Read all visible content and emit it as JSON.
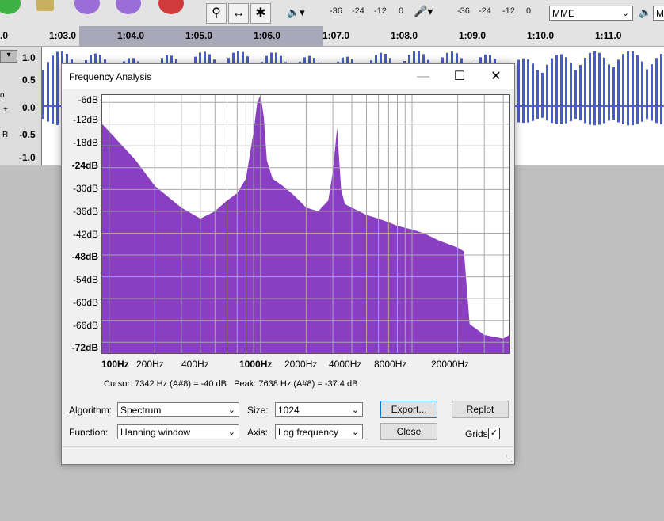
{
  "toolbar": {
    "meter_ticks_play": [
      "-36",
      "-24",
      "-12",
      "0"
    ],
    "meter_ticks_rec": [
      "-36",
      "-24",
      "-12",
      "0"
    ],
    "host": "MME",
    "host_partial": "Mi",
    "tools": [
      "zoom-icon",
      "time-shift-icon",
      "multi-tool-icon"
    ]
  },
  "ruler": {
    "labels": [
      ".0",
      "1:03.0",
      "1:04.0",
      "1:05.0",
      "1:06.0",
      "1:07.0",
      "1:08.0",
      "1:09.0",
      "1:10.0",
      "1:11.0"
    ]
  },
  "track": {
    "scale": [
      "1.0",
      "0.5",
      "0.0",
      "-0.5",
      "-1.0"
    ],
    "side_glyphs": [
      "o",
      "+",
      "R"
    ]
  },
  "dialog": {
    "title": "Frequency Analysis",
    "minimize": "—",
    "maximize": "☐",
    "close": "✕",
    "db_labels": [
      "-6dB",
      "-12dB",
      "-18dB",
      "-24dB",
      "-30dB",
      "-36dB",
      "-42dB",
      "-48dB",
      "-54dB",
      "-60dB",
      "-66dB",
      "-72dB"
    ],
    "hz_labels": [
      "100Hz",
      "200Hz",
      "400Hz",
      "1000Hz",
      "2000Hz",
      "4000Hz",
      "8000Hz",
      "20000Hz"
    ],
    "cursor_text": "Cursor: 7342 Hz (A#8) = -40 dB",
    "peak_text": "Peak: 7638 Hz (A#8) = -37.4 dB",
    "algorithm_label": "Algorithm:",
    "algorithm_value": "Spectrum",
    "function_label": "Function:",
    "function_value": "Hanning window",
    "size_label": "Size:",
    "size_value": "1024",
    "axis_label": "Axis:",
    "axis_value": "Log frequency",
    "export_label": "Export...",
    "close_label": "Close",
    "replot_label": "Replot",
    "grids_label": "Grids",
    "grids_checked": true,
    "spectrum_color": "#8a3ec2"
  },
  "chart_data": {
    "type": "area",
    "xlabel": "",
    "ylabel": "",
    "x_scale": "log",
    "xlim": [
      90,
      44000
    ],
    "ylim": [
      -75,
      -4
    ],
    "x": [
      90,
      100,
      150,
      200,
      300,
      400,
      500,
      600,
      700,
      800,
      900,
      950,
      1000,
      1050,
      1100,
      1200,
      1400,
      1600,
      1800,
      2000,
      2400,
      2800,
      3000,
      3200,
      3400,
      3600,
      4000,
      5000,
      6000,
      7000,
      8000,
      10000,
      12000,
      15000,
      20000,
      22000,
      24000,
      30000,
      40000,
      44000
    ],
    "y": [
      -12,
      -14,
      -22,
      -29,
      -35,
      -38,
      -36,
      -33,
      -31,
      -27,
      -14,
      -6,
      -4,
      -10,
      -22,
      -27,
      -29,
      -31,
      -33,
      -35,
      -36,
      -33,
      -25,
      -13,
      -30,
      -34,
      -35,
      -37,
      -38,
      -39,
      -40,
      -41,
      -42,
      -44,
      -46,
      -47,
      -67,
      -70,
      -71,
      -70
    ],
    "grid": true
  }
}
